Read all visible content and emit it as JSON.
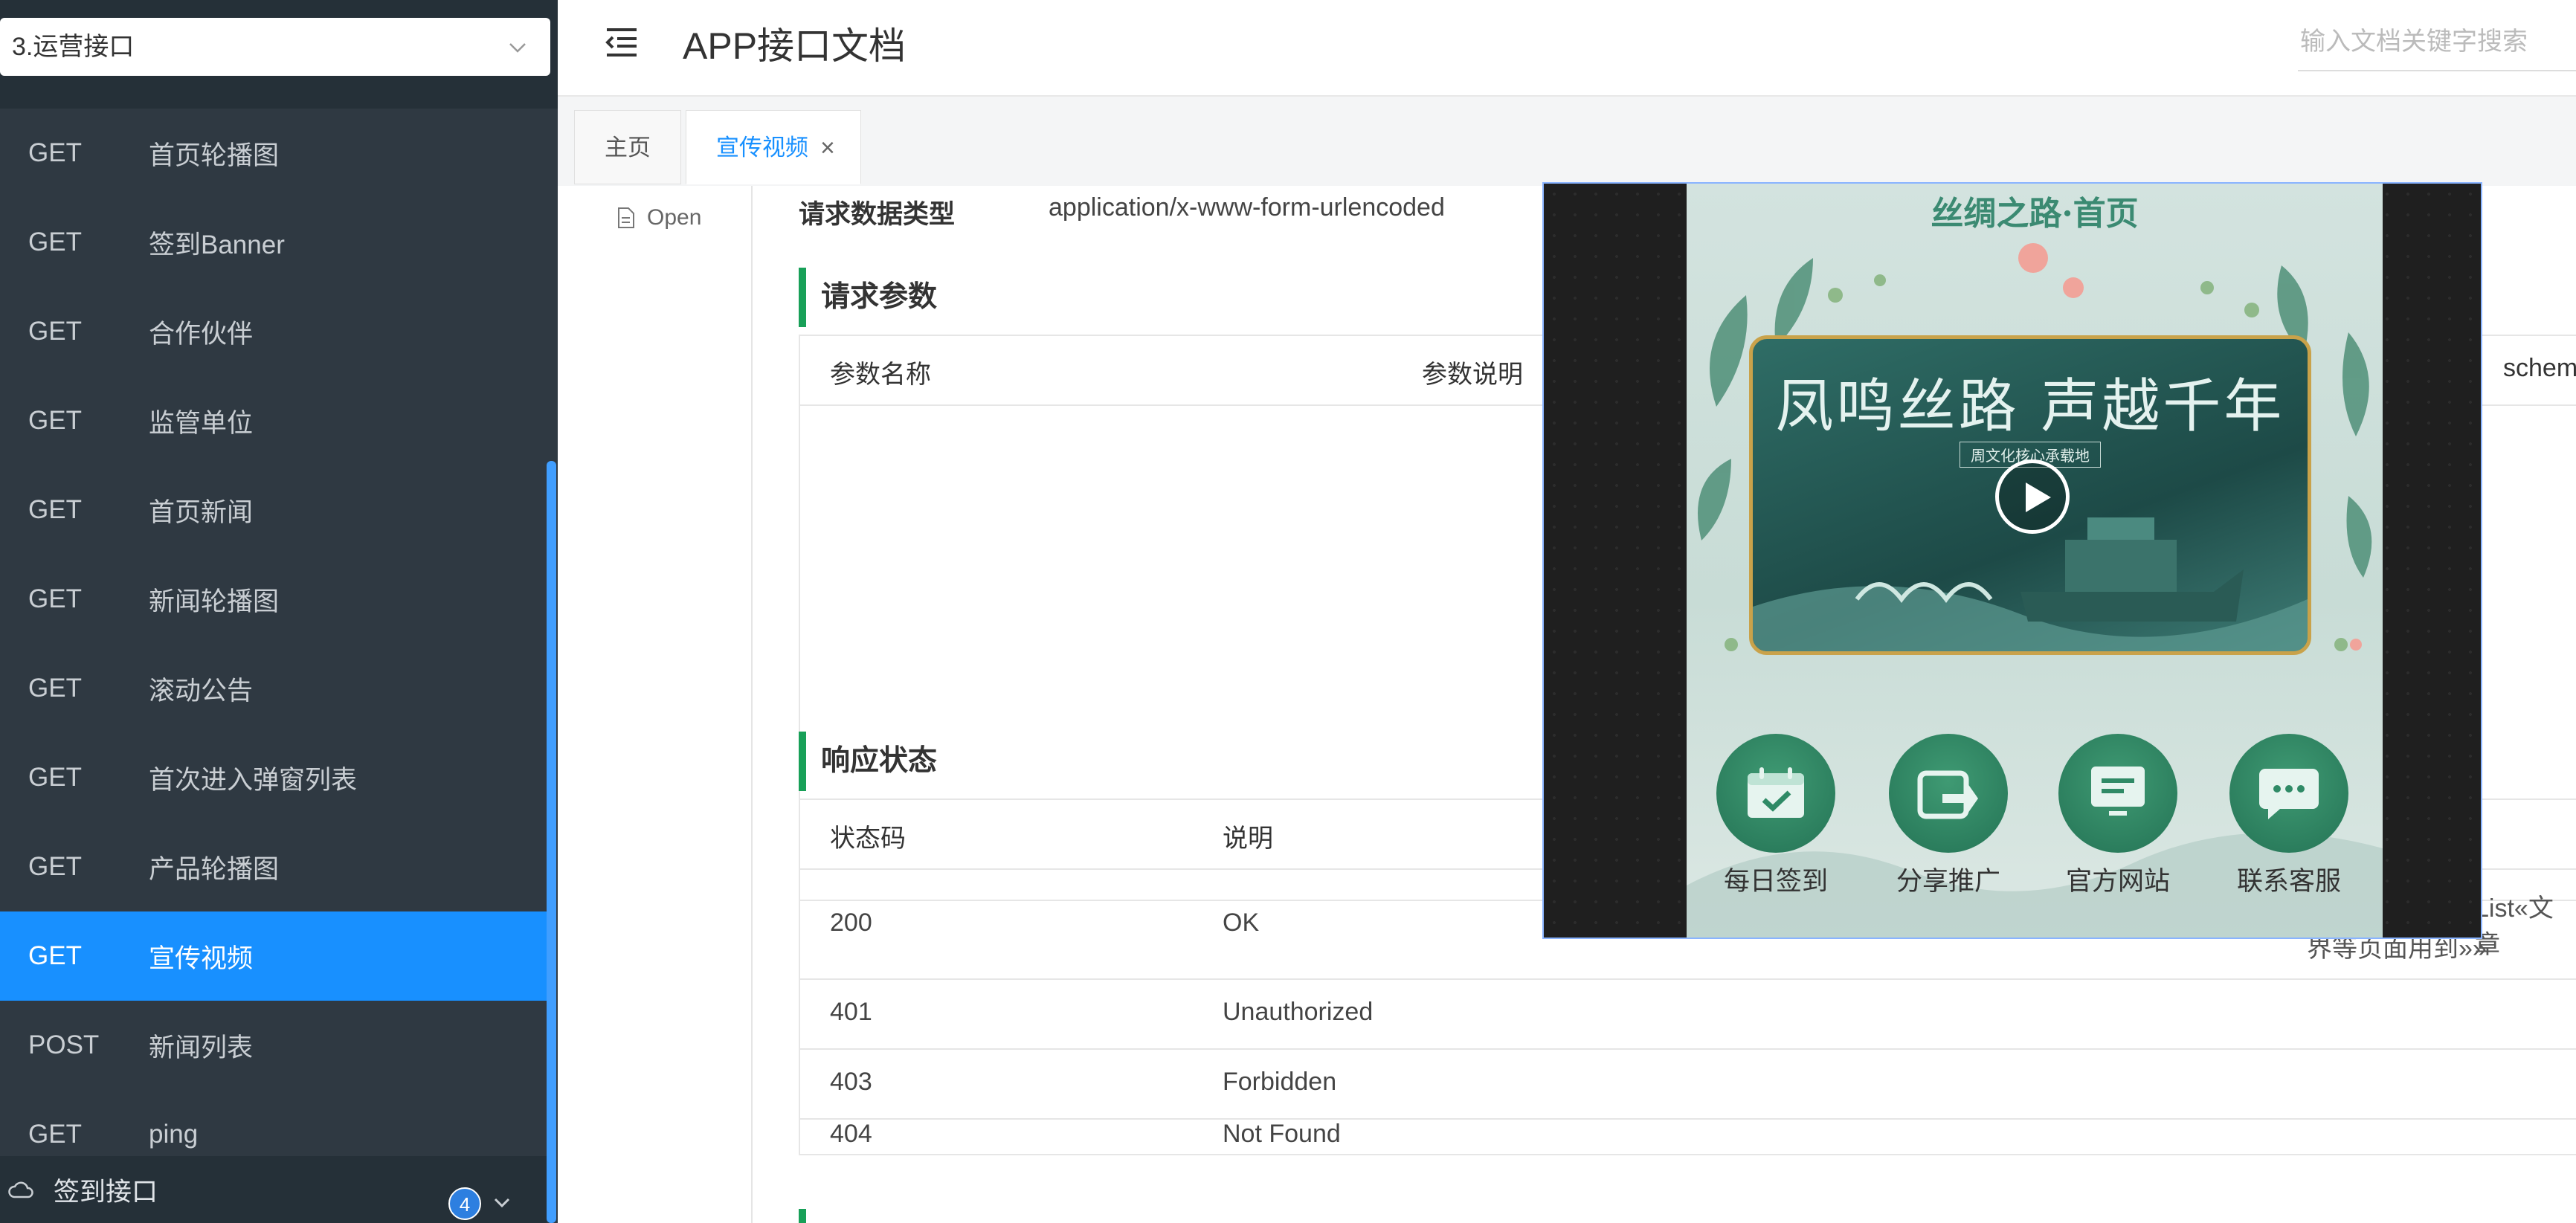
{
  "sidebar": {
    "selector": {
      "value": "3.运营接口"
    },
    "items": [
      {
        "method": "GET",
        "label": "首页轮播图"
      },
      {
        "method": "GET",
        "label": "签到Banner"
      },
      {
        "method": "GET",
        "label": "合作伙伴"
      },
      {
        "method": "GET",
        "label": "监管单位"
      },
      {
        "method": "GET",
        "label": "首页新闻"
      },
      {
        "method": "GET",
        "label": "新闻轮播图"
      },
      {
        "method": "GET",
        "label": "滚动公告"
      },
      {
        "method": "GET",
        "label": "首次进入弹窗列表"
      },
      {
        "method": "GET",
        "label": "产品轮播图"
      },
      {
        "method": "GET",
        "label": "宣传视频",
        "active": true
      },
      {
        "method": "POST",
        "label": "新闻列表"
      },
      {
        "method": "GET",
        "label": "ping"
      }
    ],
    "group": {
      "label": "签到接口",
      "badge": "4"
    }
  },
  "header": {
    "title": "APP接口文档",
    "search_placeholder": "输入文档关键字搜索"
  },
  "tabs": [
    {
      "label": "主页"
    },
    {
      "label": "宣传视频",
      "close": "×"
    }
  ],
  "left_panel": {
    "open_label": "Open"
  },
  "content": {
    "request_type_label": "请求数据类型",
    "request_type_value": "application/x-www-form-urlencoded",
    "params_title": "请求参数",
    "params_headers": [
      "参数名称",
      "参数说明",
      "schem"
    ],
    "status_title": "响应状态",
    "status_headers": [
      "状态码",
      "说明"
    ],
    "status_rows": [
      {
        "code": "200",
        "desc": "OK"
      },
      {
        "code": "401",
        "desc": "Unauthorized"
      },
      {
        "code": "403",
        "desc": "Forbidden"
      },
      {
        "code": "404",
        "desc": "Not Found"
      }
    ],
    "overflow_text_1": "List«文章",
    "overflow_text_2": "界等页面用到»»"
  },
  "video_popup": {
    "page_title": "丝绸之路·首页",
    "video_title": "凤鸣丝路 声越千年",
    "video_subtitle": "周文化核心承载地",
    "quick_actions": [
      "每日签到",
      "分享推广",
      "官方网站",
      "联系客服"
    ]
  },
  "colors": {
    "sidebar_bg": "#2f3942",
    "active": "#1890ff",
    "section_accent": "#18a058"
  }
}
